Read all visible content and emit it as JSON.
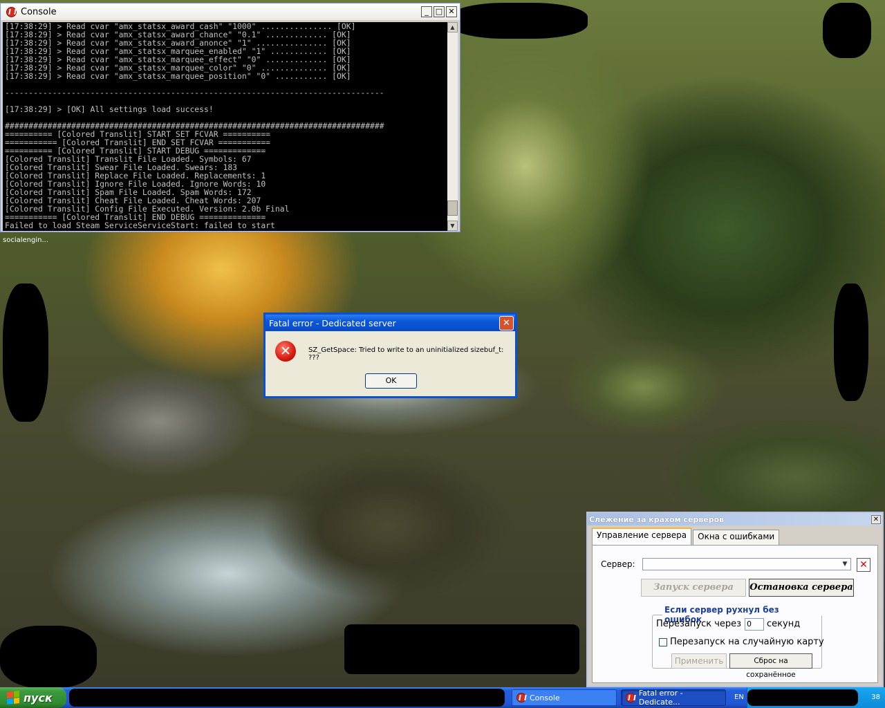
{
  "console": {
    "title": "Console",
    "log": "[17:38:29] > Read cvar \"amx_statsx_award_cash\" \"1000\" ............... [OK]\n[17:38:29] > Read cvar \"amx_statsx_award_chance\" \"0.1\" ............. [OK]\n[17:38:29] > Read cvar \"amx_statsx_award_anonce\" \"1\" ............... [OK]\n[17:38:29] > Read cvar \"amx_statsx_marquee_enabled\" \"1\" ............ [OK]\n[17:38:29] > Read cvar \"amx_statsx_marquee_effect\" \"0\" ............. [OK]\n[17:38:29] > Read cvar \"amx_statsx_marquee_color\" \"0\" .............. [OK]\n[17:38:29] > Read cvar \"amx_statsx_marquee_position\" \"0\" ........... [OK]\n\n--------------------------------------------------------------------------------\n\n[17:38:29] > [OK] All settings load success!\n\n################################################################################\n========== [Colored Translit] START SET FCVAR ==========\n=========== [Colored Translit] END SET FCVAR ===========\n========== [Colored Translit] START DEBUG =============\n[Colored Translit] Translit File Loaded. Symbols: 67\n[Colored Translit] Swear File Loaded. Swears: 183\n[Colored Translit] Replace File Loaded. Replacements: 1\n[Colored Translit] Ignore File Loaded. Ignore Words: 10\n[Colored Translit] Spam File Loaded. Spam Words: 172\n[Colored Translit] Cheat File Loaded. Cheat Words: 207\n[Colored Translit] Config File Executed. Version: 2.0b Final\n=========== [Colored Translit] END DEBUG ==============\nFailed to load Steam ServiceServiceStart: failed to start"
  },
  "desktop_tooltip": "socialengin...",
  "fatal_dialog": {
    "title": "Fatal error - Dedicated server",
    "message": "SZ_GetSpace:  Tried to write to an uninitialized sizebuf_t: ???",
    "ok_label": "OK",
    "close_glyph": "✕",
    "icon": "error-icon",
    "icon_glyph": "✕"
  },
  "monitor": {
    "title": "Слежение за крахом серверов",
    "tabs": [
      "Управление сервера",
      "Окна с ошибками"
    ],
    "server_label": "Сервер:",
    "server_value": "",
    "start_button": "Запуск сервера",
    "stop_button": "Остановка сервера",
    "group_title": "Если сервер рухнул без ошибок",
    "restart_prefix": "Перезапуск через",
    "restart_value": "0",
    "restart_suffix": "секунд",
    "random_map_label": "Перезапуск на случайную карту",
    "random_map_checked": false,
    "apply_button": "Применить",
    "reset_button": "Сброс на сохранённое"
  },
  "taskbar": {
    "start_label": "пуск",
    "buttons": [
      {
        "label": "Console",
        "icon": "hl-icon"
      },
      {
        "label": "Fatal error - Dedicate...",
        "icon": "hl-icon"
      }
    ],
    "language": "EN",
    "clock": "38"
  },
  "colors": {
    "xp_blue": "#245edb",
    "start_green": "#3c9a3c",
    "console_bg": "#000000",
    "console_text": "#c0c0c0",
    "dialog_bg": "#ece9d8",
    "group_title": "#1c3f9a"
  }
}
